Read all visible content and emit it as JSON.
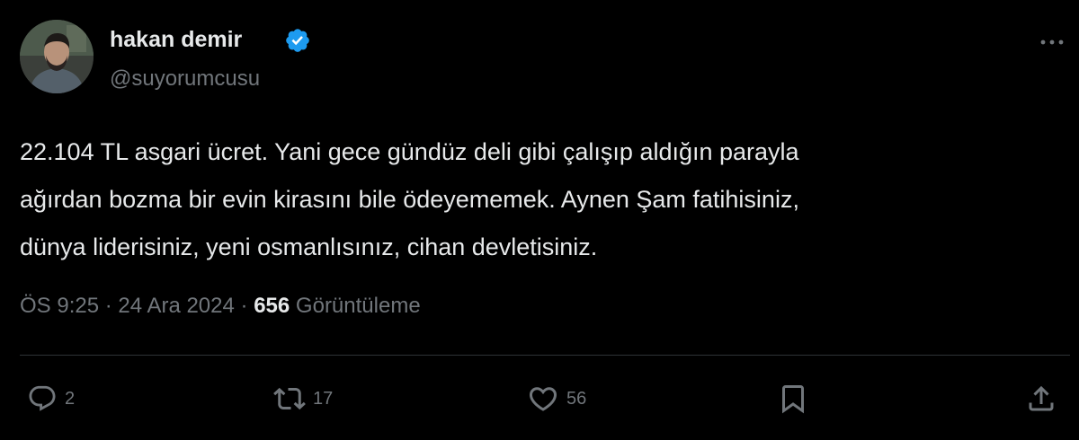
{
  "author": {
    "display_name": "hakan demir",
    "handle": "@suyorumcusu",
    "verified": true,
    "verified_color": "#1d9bf0"
  },
  "tweet": {
    "text_lines": [
      "22.104 TL asgari ücret. Yani gece gündüz deli gibi çalışıp aldığın parayla",
      "ağırdan bozma bir evin kirasını bile ödeyememek. Aynen Şam fatihisiniz,",
      "dünya liderisiniz, yeni osmanlısınız, cihan devletisiniz."
    ],
    "time": "ÖS 9:25",
    "separator": "·",
    "date": "24 Ara 2024",
    "views_count": "656",
    "views_label": "Görüntüleme"
  },
  "actions": {
    "reply": {
      "icon": "reply-icon",
      "count": "2"
    },
    "retweet": {
      "icon": "retweet-icon",
      "count": "17"
    },
    "like": {
      "icon": "heart-icon",
      "count": "56"
    },
    "bookmark": {
      "icon": "bookmark-icon"
    },
    "share": {
      "icon": "share-icon"
    }
  },
  "colors": {
    "background": "#000000",
    "text_primary": "#e7e9ea",
    "text_secondary": "#71767b",
    "divider": "#2f3336"
  }
}
